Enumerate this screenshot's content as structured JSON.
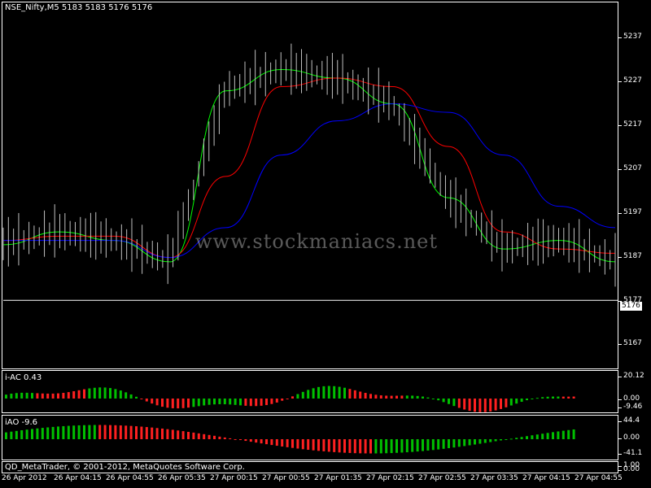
{
  "main_pane": {
    "title": "NSE_Nifty,M5  5183 5183 5176 5176",
    "price_labels": [
      "5237",
      "5227",
      "5217",
      "5207",
      "5197",
      "5187",
      "5177",
      "5167"
    ],
    "current_price": "5176",
    "watermark": "www.stockmaniacs.net"
  },
  "ac_pane": {
    "title": "i-AC 0.43",
    "labels": [
      "20.12",
      "0.00",
      "-9.46"
    ]
  },
  "ao_pane": {
    "title": "iAO -9.6",
    "labels": [
      "44.4",
      "0.00",
      "-41.1"
    ]
  },
  "volume_pane": {
    "labels": [
      "1.00",
      "0.00"
    ]
  },
  "copyright": "QD_MetaTrader, © 2001-2012, MetaQuotes Software Corp.",
  "time_labels": [
    "26 Apr 2012",
    "26 Apr 04:15",
    "26 Apr 04:55",
    "26 Apr 05:35",
    "27 Apr 00:15",
    "27 Apr 00:55",
    "27 Apr 01:35",
    "27 Apr 02:15",
    "27 Apr 02:55",
    "27 Apr 03:35",
    "27 Apr 04:15",
    "27 Apr 04:55"
  ],
  "colors": {
    "up": "#00c000",
    "down": "#ff2020",
    "ma_fast": "#00ff00",
    "ma_mid": "#ff0000",
    "ma_slow": "#0000ff",
    "bar": "#c0c0c0"
  },
  "chart_data": {
    "type": "line",
    "symbol": "NSE_Nifty",
    "timeframe": "M5",
    "ohlc_header": [
      5183,
      5183,
      5176,
      5176
    ],
    "ylim": [
      5161,
      5244
    ],
    "x": [
      "26 Apr 2012",
      "26 Apr 04:15",
      "26 Apr 04:55",
      "26 Apr 05:35",
      "27 Apr 00:15",
      "27 Apr 00:55",
      "27 Apr 01:35",
      "27 Apr 02:15",
      "27 Apr 02:55",
      "27 Apr 03:35",
      "27 Apr 04:15",
      "27 Apr 04:55"
    ],
    "series": [
      {
        "name": "",
        "values": [
          5189,
          5192,
          5190,
          5185,
          5225,
          5230,
          5228,
          5222,
          5200,
          5188,
          5190,
          5185
        ]
      },
      {
        "name": "",
        "values": [
          5190,
          5191,
          5191,
          5186,
          5205,
          5226,
          5228,
          5226,
          5212,
          5192,
          5188,
          5187
        ]
      },
      {
        "name": "",
        "values": [
          5190,
          5190,
          5190,
          5186,
          5193,
          5210,
          5218,
          5222,
          5220,
          5210,
          5198,
          5193
        ]
      }
    ],
    "ac_indicator": {
      "value": 0.43,
      "ylim": [
        -9.46,
        20.12
      ]
    },
    "ao_indicator": {
      "value": -9.6,
      "ylim": [
        -41.1,
        44.4
      ]
    }
  }
}
